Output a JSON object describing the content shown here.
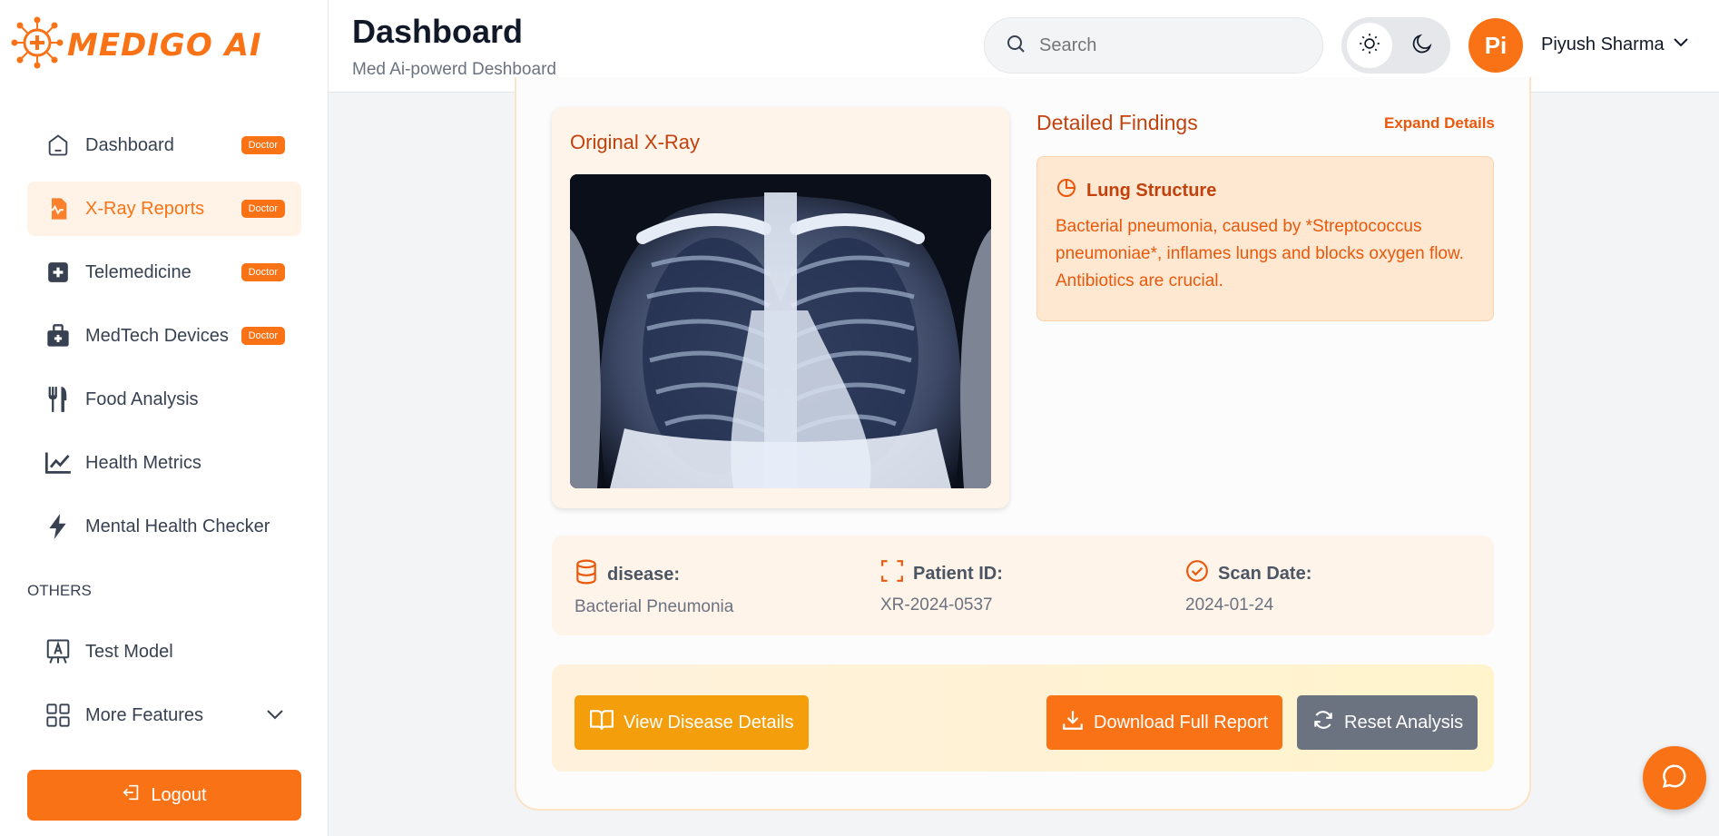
{
  "brand": {
    "name": "MEDIGO AI",
    "accent": "#f97316"
  },
  "sidebar": {
    "items": [
      {
        "label": "Dashboard",
        "icon": "home-icon",
        "badge": "Doctor",
        "active": false
      },
      {
        "label": "X-Ray Reports",
        "icon": "report-icon",
        "badge": "Doctor",
        "active": true
      },
      {
        "label": "Telemedicine",
        "icon": "medical-plus-icon",
        "badge": "Doctor",
        "active": false
      },
      {
        "label": "MedTech Devices",
        "icon": "medkit-icon",
        "badge": "Doctor",
        "active": false
      },
      {
        "label": "Food Analysis",
        "icon": "utensils-icon",
        "badge": null,
        "active": false
      },
      {
        "label": "Health Metrics",
        "icon": "chart-line-icon",
        "badge": null,
        "active": false
      },
      {
        "label": "Mental Health Checker",
        "icon": "bolt-icon",
        "badge": null,
        "active": false
      }
    ],
    "others_label": "OTHERS",
    "others": [
      {
        "label": "Test Model",
        "icon": "microscope-icon"
      },
      {
        "label": "More Features",
        "icon": "grid-icon"
      }
    ],
    "logout_label": "Logout"
  },
  "header": {
    "title": "Dashboard",
    "subtitle": "Med Ai-powerd Deshboard",
    "search_placeholder": "Search",
    "user_initials": "Pi",
    "user_name": "Piyush Sharma"
  },
  "xray": {
    "title": "Original X-Ray"
  },
  "findings": {
    "title": "Detailed Findings",
    "expand_label": "Expand Details",
    "item_title": "Lung Structure",
    "item_text": "Bacterial pneumonia, caused by *Streptococcus pneumoniae*, inflames lungs and blocks oxygen flow. Antibiotics are crucial."
  },
  "info": {
    "disease_label": "disease:",
    "disease_value": "Bacterial Pneumonia",
    "patient_label": "Patient ID:",
    "patient_value": "XR-2024-0537",
    "date_label": "Scan Date:",
    "date_value": "2024-01-24"
  },
  "actions": {
    "view_label": "View Disease Details",
    "download_label": "Download Full Report",
    "reset_label": "Reset Analysis"
  }
}
